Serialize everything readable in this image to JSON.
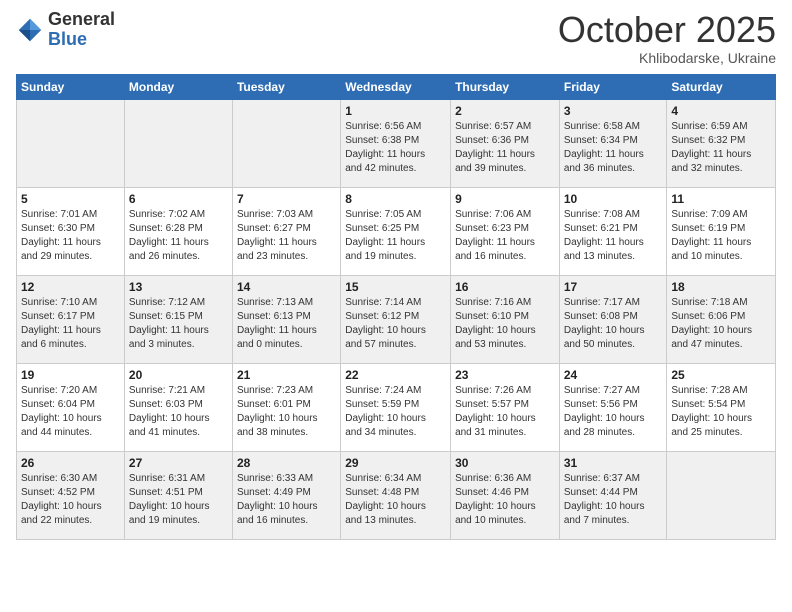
{
  "header": {
    "logo_general": "General",
    "logo_blue": "Blue",
    "title": "October 2025",
    "location": "Khlibodarske, Ukraine"
  },
  "days_of_week": [
    "Sunday",
    "Monday",
    "Tuesday",
    "Wednesday",
    "Thursday",
    "Friday",
    "Saturday"
  ],
  "weeks": [
    [
      {
        "date": "",
        "info": ""
      },
      {
        "date": "",
        "info": ""
      },
      {
        "date": "",
        "info": ""
      },
      {
        "date": "1",
        "info": "Sunrise: 6:56 AM\nSunset: 6:38 PM\nDaylight: 11 hours\nand 42 minutes."
      },
      {
        "date": "2",
        "info": "Sunrise: 6:57 AM\nSunset: 6:36 PM\nDaylight: 11 hours\nand 39 minutes."
      },
      {
        "date": "3",
        "info": "Sunrise: 6:58 AM\nSunset: 6:34 PM\nDaylight: 11 hours\nand 36 minutes."
      },
      {
        "date": "4",
        "info": "Sunrise: 6:59 AM\nSunset: 6:32 PM\nDaylight: 11 hours\nand 32 minutes."
      }
    ],
    [
      {
        "date": "5",
        "info": "Sunrise: 7:01 AM\nSunset: 6:30 PM\nDaylight: 11 hours\nand 29 minutes."
      },
      {
        "date": "6",
        "info": "Sunrise: 7:02 AM\nSunset: 6:28 PM\nDaylight: 11 hours\nand 26 minutes."
      },
      {
        "date": "7",
        "info": "Sunrise: 7:03 AM\nSunset: 6:27 PM\nDaylight: 11 hours\nand 23 minutes."
      },
      {
        "date": "8",
        "info": "Sunrise: 7:05 AM\nSunset: 6:25 PM\nDaylight: 11 hours\nand 19 minutes."
      },
      {
        "date": "9",
        "info": "Sunrise: 7:06 AM\nSunset: 6:23 PM\nDaylight: 11 hours\nand 16 minutes."
      },
      {
        "date": "10",
        "info": "Sunrise: 7:08 AM\nSunset: 6:21 PM\nDaylight: 11 hours\nand 13 minutes."
      },
      {
        "date": "11",
        "info": "Sunrise: 7:09 AM\nSunset: 6:19 PM\nDaylight: 11 hours\nand 10 minutes."
      }
    ],
    [
      {
        "date": "12",
        "info": "Sunrise: 7:10 AM\nSunset: 6:17 PM\nDaylight: 11 hours\nand 6 minutes."
      },
      {
        "date": "13",
        "info": "Sunrise: 7:12 AM\nSunset: 6:15 PM\nDaylight: 11 hours\nand 3 minutes."
      },
      {
        "date": "14",
        "info": "Sunrise: 7:13 AM\nSunset: 6:13 PM\nDaylight: 11 hours\nand 0 minutes."
      },
      {
        "date": "15",
        "info": "Sunrise: 7:14 AM\nSunset: 6:12 PM\nDaylight: 10 hours\nand 57 minutes."
      },
      {
        "date": "16",
        "info": "Sunrise: 7:16 AM\nSunset: 6:10 PM\nDaylight: 10 hours\nand 53 minutes."
      },
      {
        "date": "17",
        "info": "Sunrise: 7:17 AM\nSunset: 6:08 PM\nDaylight: 10 hours\nand 50 minutes."
      },
      {
        "date": "18",
        "info": "Sunrise: 7:18 AM\nSunset: 6:06 PM\nDaylight: 10 hours\nand 47 minutes."
      }
    ],
    [
      {
        "date": "19",
        "info": "Sunrise: 7:20 AM\nSunset: 6:04 PM\nDaylight: 10 hours\nand 44 minutes."
      },
      {
        "date": "20",
        "info": "Sunrise: 7:21 AM\nSunset: 6:03 PM\nDaylight: 10 hours\nand 41 minutes."
      },
      {
        "date": "21",
        "info": "Sunrise: 7:23 AM\nSunset: 6:01 PM\nDaylight: 10 hours\nand 38 minutes."
      },
      {
        "date": "22",
        "info": "Sunrise: 7:24 AM\nSunset: 5:59 PM\nDaylight: 10 hours\nand 34 minutes."
      },
      {
        "date": "23",
        "info": "Sunrise: 7:26 AM\nSunset: 5:57 PM\nDaylight: 10 hours\nand 31 minutes."
      },
      {
        "date": "24",
        "info": "Sunrise: 7:27 AM\nSunset: 5:56 PM\nDaylight: 10 hours\nand 28 minutes."
      },
      {
        "date": "25",
        "info": "Sunrise: 7:28 AM\nSunset: 5:54 PM\nDaylight: 10 hours\nand 25 minutes."
      }
    ],
    [
      {
        "date": "26",
        "info": "Sunrise: 6:30 AM\nSunset: 4:52 PM\nDaylight: 10 hours\nand 22 minutes."
      },
      {
        "date": "27",
        "info": "Sunrise: 6:31 AM\nSunset: 4:51 PM\nDaylight: 10 hours\nand 19 minutes."
      },
      {
        "date": "28",
        "info": "Sunrise: 6:33 AM\nSunset: 4:49 PM\nDaylight: 10 hours\nand 16 minutes."
      },
      {
        "date": "29",
        "info": "Sunrise: 6:34 AM\nSunset: 4:48 PM\nDaylight: 10 hours\nand 13 minutes."
      },
      {
        "date": "30",
        "info": "Sunrise: 6:36 AM\nSunset: 4:46 PM\nDaylight: 10 hours\nand 10 minutes."
      },
      {
        "date": "31",
        "info": "Sunrise: 6:37 AM\nSunset: 4:44 PM\nDaylight: 10 hours\nand 7 minutes."
      },
      {
        "date": "",
        "info": ""
      }
    ]
  ]
}
